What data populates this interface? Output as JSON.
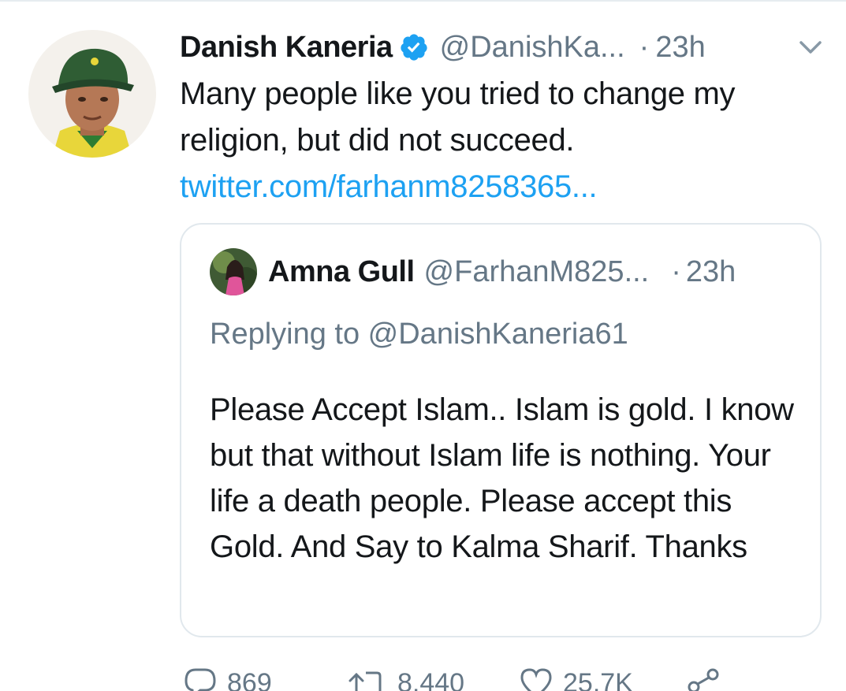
{
  "tweet": {
    "author_name": "Danish Kaneria",
    "handle": "@DanishKa...",
    "separator": "·",
    "time": "23h",
    "text": "Many people like you tried to change my religion, but did not succeed.",
    "link": "twitter.com/farhanm8258365..."
  },
  "quoted": {
    "author_name": "Amna Gull",
    "handle": "@FarhanM825...",
    "separator": "·",
    "time": "23h",
    "replying_to": "Replying to @DanishKaneria61",
    "text": "Please Accept Islam.. Islam is gold. I know but that without Islam life is nothing. Your life a death people. Please accept this Gold. And Say to Kalma Sharif. Thanks"
  },
  "actions": {
    "replies": "869",
    "retweets": "8,440",
    "likes": "25.7K"
  },
  "colors": {
    "accent": "#1da1f2",
    "muted": "#657786",
    "border": "#e1e8ed",
    "text": "#14171a"
  },
  "icons": {
    "verified": "verified-badge-icon",
    "menu": "chevron-down-icon",
    "reply": "reply-icon",
    "retweet": "retweet-icon",
    "like": "heart-icon",
    "share": "share-icon"
  }
}
